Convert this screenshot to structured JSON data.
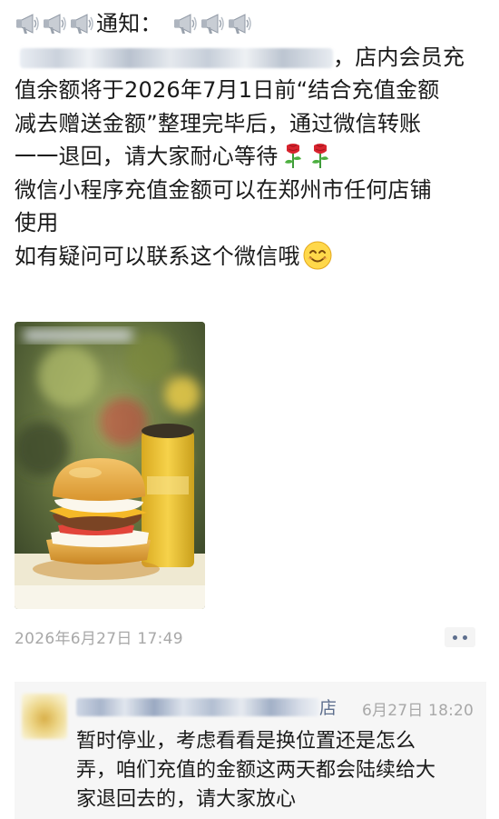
{
  "post": {
    "notice_label": "通知：",
    "line1_suffix": "，店内会员充",
    "line2": "值余额将于2026年7月1日前“结合充值金额",
    "line3": "减去赠送金额”整理完毕后，通过微信转账",
    "line4": "一一退回，请大家耐心等待",
    "line5": "微信小程序充值金额可以在郑州市任何店铺",
    "line6": "使用",
    "line7": "如有疑问可以联系这个微信哦",
    "timestamp": "2026年6月27日 17:49",
    "icons": {
      "megaphone": "megaphone-icon",
      "rose": "rose-emoji-icon",
      "smile": "smile-emoji-icon",
      "more": "more-dots-icon"
    }
  },
  "comment": {
    "name_tail": "店",
    "time": "6月27日 18:20",
    "line1": "暂时停业，考虑看看是换位置还是怎么",
    "line2": "弄，咱们充值的金额这两天都会陆续给大",
    "line3": "家退回去的，请大家放心"
  },
  "colors": {
    "link_blue": "#5e6f8e",
    "timestamp_gray": "#a8a8a8",
    "comment_bg": "#f6f6f6"
  }
}
